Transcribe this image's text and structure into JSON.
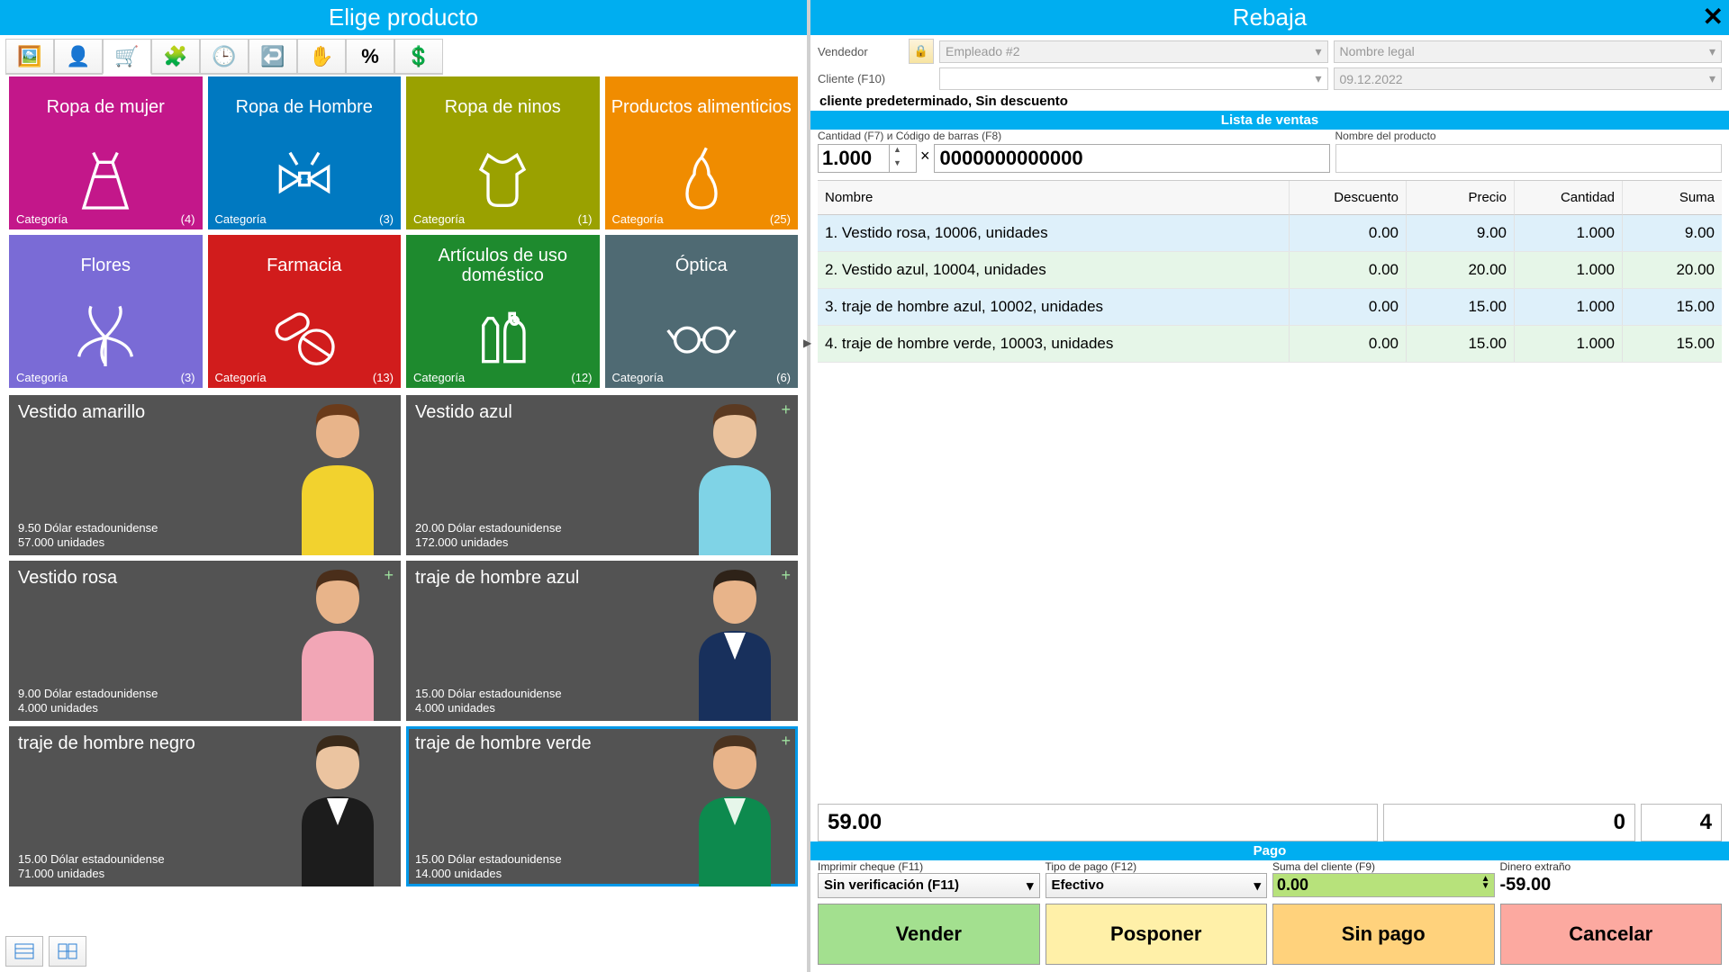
{
  "left": {
    "title": "Elige producto",
    "categories": [
      {
        "title": "Ropa de mujer",
        "color": "#c3178a",
        "count": "(4)",
        "footer": "Categoría",
        "icon": "dress"
      },
      {
        "title": "Ropa de Hombre",
        "color": "#0079c1",
        "count": "(3)",
        "footer": "Categoría",
        "icon": "bowtie"
      },
      {
        "title": "Ropa de ninos",
        "color": "#9aa100",
        "count": "(1)",
        "footer": "Categoría",
        "icon": "onesie"
      },
      {
        "title": "Productos alimenticios",
        "color": "#f08c00",
        "count": "(25)",
        "footer": "Categoría",
        "icon": "pear"
      },
      {
        "title": "Flores",
        "color": "#7a6bd6",
        "count": "(3)",
        "footer": "Categoría",
        "icon": "flower"
      },
      {
        "title": "Farmacia",
        "color": "#d11c1c",
        "count": "(13)",
        "footer": "Categoría",
        "icon": "pills"
      },
      {
        "title": "Artículos de uso doméstico",
        "color": "#1e8a2e",
        "count": "(12)",
        "footer": "Categoría",
        "icon": "bottles"
      },
      {
        "title": "Óptica",
        "color": "#4f6a73",
        "count": "(6)",
        "footer": "Categoría",
        "icon": "glasses"
      }
    ],
    "products": [
      {
        "title": "Vestido amarillo",
        "price": "9.50 Dólar estadounidense",
        "stock": "57.000 unidades",
        "plus": false,
        "selected": false,
        "garment": "#f2d22e",
        "skin": "#e8b48a",
        "hair": "#6b3b1a"
      },
      {
        "title": "Vestido azul",
        "price": "20.00 Dólar estadounidense",
        "stock": "172.000 unidades",
        "plus": true,
        "selected": false,
        "garment": "#7fd3e6",
        "skin": "#eac29d",
        "hair": "#5b3a22"
      },
      {
        "title": "Vestido rosa",
        "price": "9.00 Dólar estadounidense",
        "stock": "4.000 unidades",
        "plus": true,
        "selected": false,
        "garment": "#f2a6b6",
        "skin": "#e8b48a",
        "hair": "#4a2e1a"
      },
      {
        "title": "traje de hombre azul",
        "price": "15.00 Dólar estadounidense",
        "stock": "4.000 unidades",
        "plus": true,
        "selected": false,
        "garment": "#18305c",
        "skin": "#e8b48a",
        "hair": "#2e2218",
        "shirt": "#ffffff"
      },
      {
        "title": "traje de hombre negro",
        "price": "15.00 Dólar estadounidense",
        "stock": "71.000 unidades",
        "plus": false,
        "selected": false,
        "garment": "#1c1c1c",
        "skin": "#ebc4a0",
        "hair": "#3a2a1a",
        "shirt": "#ffffff"
      },
      {
        "title": "traje de hombre verde",
        "price": "15.00 Dólar estadounidense",
        "stock": "14.000 unidades",
        "plus": true,
        "selected": true,
        "garment": "#0d8a4e",
        "skin": "#e8b48a",
        "hair": "#4a3320",
        "shirt": "#e6f6ea"
      }
    ]
  },
  "right": {
    "title": "Rebaja",
    "vendor_label": "Vendedor",
    "vendor_value": "Empleado #2",
    "legal_placeholder": "Nombre legal",
    "client_label": "Cliente (F10)",
    "date_value": "09.12.2022",
    "status": "cliente predeterminado, Sin descuento",
    "sales_header": "Lista de ventas",
    "qty_label": "Cantidad (F7) и Código de barras (F8)",
    "qty_value": "1.000",
    "barcode_value": "0000000000000",
    "pname_label": "Nombre del producto",
    "table": {
      "headers": {
        "name": "Nombre",
        "desc": "Descuento",
        "prec": "Precio",
        "cant": "Cantidad",
        "suma": "Suma"
      },
      "rows": [
        {
          "name": "1. Vestido rosa, 10006, unidades",
          "desc": "0.00",
          "prec": "9.00",
          "cant": "1.000",
          "suma": "9.00"
        },
        {
          "name": "2. Vestido azul, 10004, unidades",
          "desc": "0.00",
          "prec": "20.00",
          "cant": "1.000",
          "suma": "20.00"
        },
        {
          "name": "3. traje de hombre azul, 10002, unidades",
          "desc": "0.00",
          "prec": "15.00",
          "cant": "1.000",
          "suma": "15.00"
        },
        {
          "name": "4. traje de hombre verde, 10003, unidades",
          "desc": "0.00",
          "prec": "15.00",
          "cant": "1.000",
          "suma": "15.00"
        }
      ]
    },
    "totals": {
      "sum": "59.00",
      "discount": "0",
      "count": "4"
    },
    "payment": {
      "header": "Pago",
      "print_label": "Imprimir cheque (F11)",
      "print_value": "Sin verificación (F11)",
      "type_label": "Tipo de pago (F12)",
      "type_value": "Efectivo",
      "client_sum_label": "Suma del cliente (F9)",
      "client_sum_value": "0.00",
      "change_label": "Dinero extraño",
      "change_value": "-59.00"
    },
    "actions": {
      "vender": "Vender",
      "posponer": "Posponer",
      "sinpago": "Sin pago",
      "cancelar": "Cancelar"
    }
  }
}
